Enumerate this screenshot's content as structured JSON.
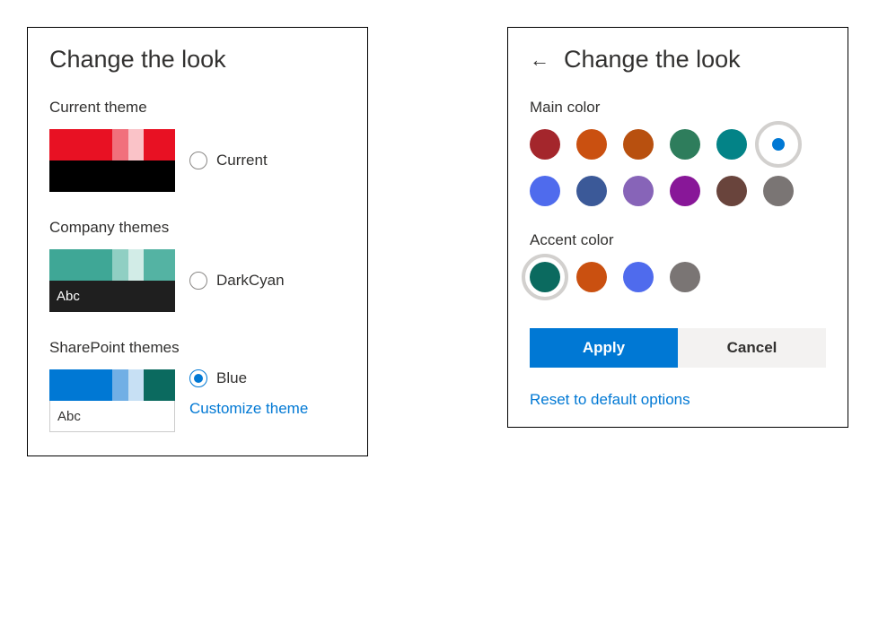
{
  "leftPanel": {
    "title": "Change the look",
    "sections": {
      "current": {
        "label": "Current theme",
        "themeName": "Current",
        "previewText": "",
        "colors": {
          "swatch1": "#e81123",
          "swatch2": "#f1707c",
          "swatch3": "#fac3c8",
          "swatch4": "#e81123",
          "bottom": "#000000"
        },
        "selected": false
      },
      "company": {
        "label": "Company themes",
        "themeName": "DarkCyan",
        "previewText": "Abc",
        "colors": {
          "swatch1": "#3fa796",
          "swatch2": "#90cfc3",
          "swatch3": "#d2ece7",
          "swatch4": "#54b3a3",
          "bottom": "#1f1f1f"
        },
        "selected": false
      },
      "sharepoint": {
        "label": "SharePoint themes",
        "themeName": "Blue",
        "customizeLabel": "Customize theme",
        "previewText": "Abc",
        "colors": {
          "swatch1": "#0078d4",
          "swatch2": "#71afe5",
          "swatch3": "#c7e0f4",
          "swatch4": "#0b6a5f",
          "bottom": "#ffffff"
        },
        "selected": true
      }
    }
  },
  "rightPanel": {
    "title": "Change the look",
    "mainColor": {
      "label": "Main color",
      "colors": [
        {
          "hex": "#a4262c",
          "selected": false
        },
        {
          "hex": "#ca5010",
          "selected": false
        },
        {
          "hex": "#b8500f",
          "selected": false
        },
        {
          "hex": "#2e7d5c",
          "selected": false
        },
        {
          "hex": "#038387",
          "selected": false
        },
        {
          "hex": "#0078d4",
          "selected": true
        },
        {
          "hex": "#4f6bed",
          "selected": false
        },
        {
          "hex": "#3b5998",
          "selected": false
        },
        {
          "hex": "#8764b8",
          "selected": false
        },
        {
          "hex": "#881798",
          "selected": false
        },
        {
          "hex": "#69443c",
          "selected": false
        },
        {
          "hex": "#7a7574",
          "selected": false
        }
      ]
    },
    "accentColor": {
      "label": "Accent color",
      "colors": [
        {
          "hex": "#0b6a5f",
          "selected": true
        },
        {
          "hex": "#ca5010",
          "selected": false
        },
        {
          "hex": "#4f6bed",
          "selected": false
        },
        {
          "hex": "#7a7574",
          "selected": false
        }
      ]
    },
    "applyLabel": "Apply",
    "cancelLabel": "Cancel",
    "resetLabel": "Reset to default options"
  }
}
